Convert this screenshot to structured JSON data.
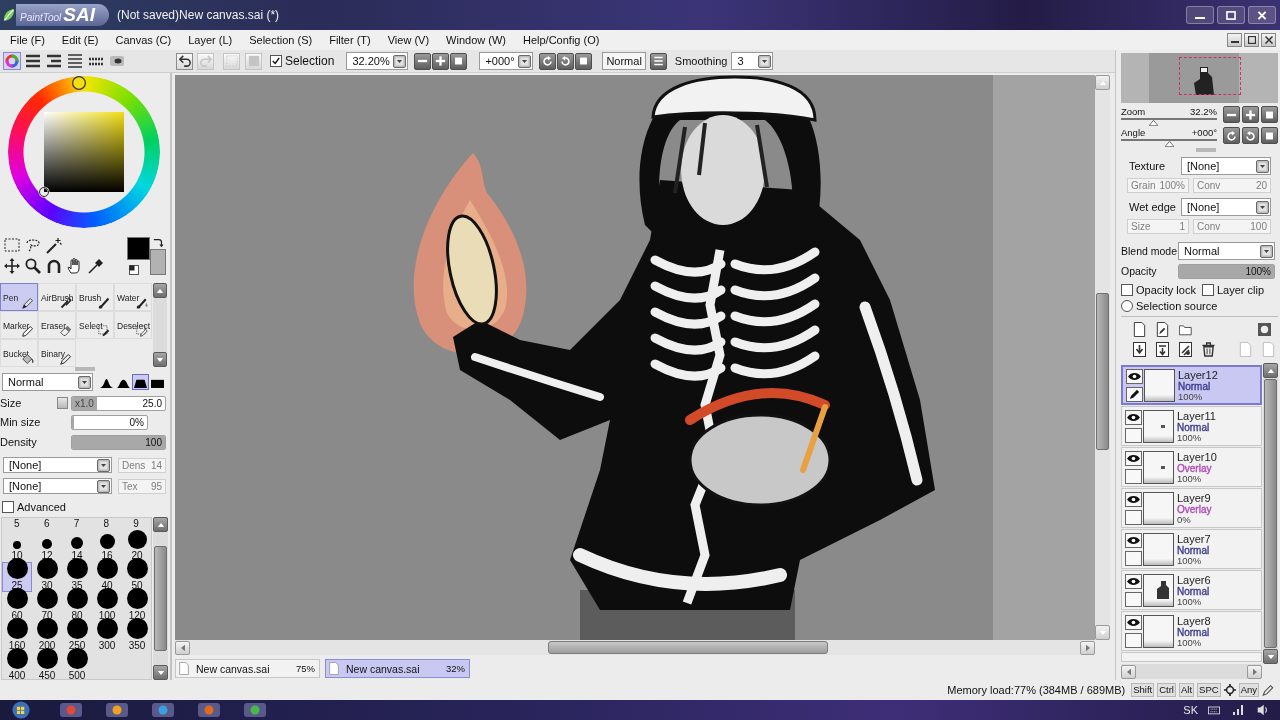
{
  "window": {
    "logo_script": "PaintTool",
    "logo_name": "SAI",
    "title": "(Not saved)New canvas.sai (*)"
  },
  "menu": [
    "File (F)",
    "Edit (E)",
    "Canvas (C)",
    "Layer (L)",
    "Selection (S)",
    "Filter (T)",
    "View (V)",
    "Window (W)",
    "Help/Config (O)"
  ],
  "color_modes": [
    {
      "kind": "wheel",
      "selected": true
    },
    {
      "kind": "rgb",
      "selected": false
    },
    {
      "kind": "hsv",
      "selected": false
    },
    {
      "kind": "list",
      "selected": false
    },
    {
      "kind": "swatches",
      "selected": false
    },
    {
      "kind": "scratchpad",
      "selected": false
    }
  ],
  "toolbar": {
    "history": [
      {
        "kind": "undo",
        "disabled": false
      },
      {
        "kind": "redo",
        "disabled": true
      },
      {
        "kind": "deselect",
        "disabled": true
      },
      {
        "kind": "invert",
        "disabled": true
      }
    ],
    "selection": {
      "label": "Selection",
      "checked": true
    },
    "zoom": "32.20%",
    "angle": "+000°",
    "blend": "Normal",
    "smoothing": {
      "label": "Smoothing",
      "value": "3"
    }
  },
  "color_picker": {
    "hue": {
      "color": "#f2de12"
    },
    "primary": {
      "color": "#000000"
    },
    "secondary": {
      "color": "#b2b2b2"
    }
  },
  "tools": [
    {
      "label": "Pen",
      "kind": "pen",
      "selected": true
    },
    {
      "label": "AirBrush",
      "kind": "airbrush",
      "selected": false
    },
    {
      "label": "Brush",
      "kind": "brush",
      "selected": false
    },
    {
      "label": "Water",
      "kind": "water",
      "selected": false
    },
    {
      "label": "Marker",
      "kind": "marker",
      "selected": false
    },
    {
      "label": "Eraser",
      "kind": "eraser",
      "selected": false
    },
    {
      "label": "Select",
      "kind": "select",
      "selected": false
    },
    {
      "label": "Deselect",
      "kind": "deselect",
      "selected": false
    },
    {
      "label": "Bucket",
      "kind": "bucket",
      "selected": false
    },
    {
      "label": "Binary",
      "kind": "binary",
      "selected": false
    }
  ],
  "brush": {
    "mode": "Normal",
    "shapes": [
      {
        "kind": "soft",
        "selected": false
      },
      {
        "kind": "medium",
        "selected": false
      },
      {
        "kind": "hard",
        "selected": true
      },
      {
        "kind": "square",
        "selected": false
      }
    ],
    "size": {
      "label": "Size",
      "multiplier": "x1.0",
      "value": "25.0",
      "level": 0.27
    },
    "min_size": {
      "label": "Min size",
      "value": "0%",
      "level": 0
    },
    "density": {
      "label": "Density",
      "value": "100",
      "level": 1
    },
    "shape_texture": {
      "value": "[None]",
      "field_label": "Dens",
      "field_value": "14",
      "disabled": true
    },
    "paper_texture": {
      "value": "[None]",
      "field_label": "Tex",
      "field_value": "95",
      "disabled": true
    },
    "advanced": {
      "label": "Advanced",
      "checked": false
    }
  },
  "brush_sizes": {
    "partial_row": [
      "5",
      "6",
      "7",
      "8",
      "9"
    ],
    "items": [
      {
        "label": "10",
        "selected": false
      },
      {
        "label": "12",
        "selected": false
      },
      {
        "label": "14",
        "selected": false
      },
      {
        "label": "16",
        "selected": false
      },
      {
        "label": "20",
        "selected": false
      },
      {
        "label": "25",
        "selected": true
      },
      {
        "label": "30",
        "selected": false
      },
      {
        "label": "35",
        "selected": false
      },
      {
        "label": "40",
        "selected": false
      },
      {
        "label": "50",
        "selected": false
      },
      {
        "label": "60",
        "selected": false
      },
      {
        "label": "70",
        "selected": false
      },
      {
        "label": "80",
        "selected": false
      },
      {
        "label": "100",
        "selected": false
      },
      {
        "label": "120",
        "selected": false
      },
      {
        "label": "160",
        "selected": false
      },
      {
        "label": "200",
        "selected": false
      },
      {
        "label": "250",
        "selected": false
      },
      {
        "label": "300",
        "selected": false
      },
      {
        "label": "350",
        "selected": false
      },
      {
        "label": "400",
        "selected": false
      },
      {
        "label": "450",
        "selected": false
      },
      {
        "label": "500",
        "selected": false
      }
    ]
  },
  "canvas": {
    "tabs": [
      {
        "name": "New canvas.sai",
        "zoom": "75%",
        "selected": false
      },
      {
        "name": "New canvas.sai",
        "zoom": "32%",
        "selected": true
      }
    ]
  },
  "navigator": {
    "zoom": {
      "label": "Zoom",
      "value": "32.2%",
      "level": 0.33
    },
    "angle": {
      "label": "Angle",
      "value": "+000°",
      "level": 0.5
    }
  },
  "layer_settings": {
    "texture": {
      "label": "Texture",
      "value": "[None]",
      "fields": [
        {
          "label": "Grain",
          "value": "100%",
          "disabled": true
        },
        {
          "label": "Conv",
          "value": "20",
          "disabled": true
        }
      ]
    },
    "wet_edge": {
      "label": "Wet edge",
      "value": "[None]",
      "fields": [
        {
          "label": "Size",
          "value": "1",
          "disabled": true
        },
        {
          "label": "Conv",
          "value": "100",
          "disabled": true
        }
      ]
    },
    "blend_mode": {
      "label": "Blend mode",
      "value": "Normal"
    },
    "opacity": {
      "label": "Opacity",
      "value": "100%",
      "level": 1
    },
    "opacity_lock": {
      "label": "Opacity lock",
      "checked": false
    },
    "layer_clip": {
      "label": "Layer clip",
      "checked": false
    },
    "selection_source": {
      "label": "Selection source",
      "selected": false
    }
  },
  "layers": [
    {
      "name": "Layer12",
      "mode": {
        "label": "Normal",
        "color": "#3c3c8c"
      },
      "opacity": "100%",
      "visible": true,
      "selected": true,
      "kind": "blank"
    },
    {
      "name": "Layer11",
      "mode": {
        "label": "Normal",
        "color": "#3c3c8c"
      },
      "opacity": "100%",
      "visible": true,
      "selected": false,
      "kind": "speck"
    },
    {
      "name": "Layer10",
      "mode": {
        "label": "Overlay",
        "color": "#b048b8"
      },
      "opacity": "100%",
      "visible": true,
      "selected": false,
      "kind": "speck"
    },
    {
      "name": "Layer9",
      "mode": {
        "label": "Overlay",
        "color": "#b048b8"
      },
      "opacity": "0%",
      "visible": true,
      "selected": false,
      "kind": "blank"
    },
    {
      "name": "Layer7",
      "mode": {
        "label": "Normal",
        "color": "#3c3c8c"
      },
      "opacity": "100%",
      "visible": true,
      "selected": false,
      "kind": "blank"
    },
    {
      "name": "Layer6",
      "mode": {
        "label": "Normal",
        "color": "#3c3c8c"
      },
      "opacity": "100%",
      "visible": true,
      "selected": false,
      "kind": "figure"
    },
    {
      "name": "Layer8",
      "mode": {
        "label": "Normal",
        "color": "#3c3c8c"
      },
      "opacity": "100%",
      "visible": true,
      "selected": false,
      "kind": "blank"
    }
  ],
  "status": {
    "memory": "Memory load:77% (384MB / 689MB)",
    "keys": [
      "Shift",
      "Ctrl",
      "Alt",
      "SPC"
    ],
    "any": "Any"
  },
  "taskbar": {
    "language": "SK"
  }
}
